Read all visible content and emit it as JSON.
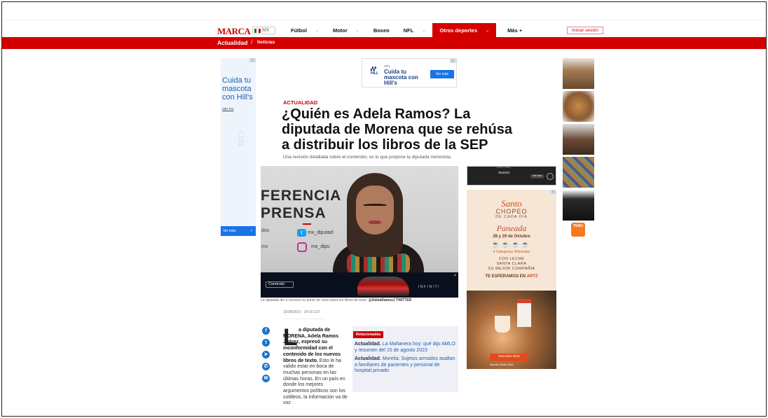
{
  "nav": {
    "logo": "MARCA",
    "edition": "MX",
    "items": [
      {
        "label": "Fútbol",
        "dropdown": true
      },
      {
        "label": "Motor",
        "dropdown": true
      },
      {
        "label": "Boxeo",
        "dropdown": false
      },
      {
        "label": "NFL",
        "dropdown": true
      },
      {
        "label": "Otros deportes",
        "dropdown": true,
        "active": true
      },
      {
        "label": "Más +",
        "dropdown": false
      }
    ],
    "login": "Iniciar sesión"
  },
  "section_bar": {
    "section": "Actualidad",
    "separator": "/",
    "subsection": "Noticias"
  },
  "ads": {
    "left": {
      "headline": "Cuida tu mascota con Hill's",
      "small": "Hills Pet",
      "cta": "Ver más"
    },
    "top": {
      "label": "Hill's",
      "headline": "Cuida tu mascota con Hill's",
      "cta": "Ver más"
    },
    "video": {
      "cta": "Conócelo",
      "brand": "INFINITI"
    },
    "car": {
      "label": "PUBLICIDAD",
      "text": "SUZUKI",
      "cta": "Ver más"
    },
    "santa_clara": {
      "title1": "Santo",
      "title2": "CHOPEO",
      "title3": "DE CADA DÍA",
      "title4": "Paneada",
      "dates": "28 y 29 de Octubre",
      "category": "4 Categorías Diferentes",
      "line1": "CON LECHE",
      "line2": "SANTA CLARA",
      "line3": "SU MEJOR COMPAÑÍA",
      "cta_prefix": "TE ESPERAMOS EN",
      "cta_place": "ARTZ",
      "button": "Descubre MÁS",
      "fine": "Atención Santa Clara"
    },
    "temu": "TEMU"
  },
  "article": {
    "kicker": "ACTUALIDAD",
    "title": "¿Quién es Adela Ramos? La diputada de Morena que se rehúsa a distribuir los libros de la SEP",
    "subtitle": "Una revisión detallada sobre el contenido, es lo que propone la diputada morenista.",
    "photo": {
      "word1": "FERENCIA",
      "word2": "PRENSA",
      "handle_tw": "mx_diputad",
      "handle_ig": "mx_dipu",
      "side1": "dos",
      "side2": "mx"
    },
    "caption_text": "La diputada dio a conocer su punto de vista sobre los libros de texto.",
    "caption_credit": "@AdelaRamosJ TWITTER",
    "date": "15/08/2023 - 14:16 CST",
    "dropcap": "L",
    "lead_bold": "a diputada de MORENA, Adela Ramos Juárez, expresó su inconformidad con el contenido de los nuevos libros de texto.",
    "lead_rest": "Esto le ha valido estar en boca de muchas personas en las últimas horas. En un país en donde los mejores argumentos políticos son los cotilleos, la información va de voz"
  },
  "related": {
    "tag": "Relacionadas",
    "items": [
      {
        "section": "Actualidad.",
        "title": "La Mañanera hoy: qué dijo AMLO y resumen del 15 de agosto 2023"
      },
      {
        "section": "Actualidad.",
        "title": "Morelia: Sujetos armados asaltan a familiares de pacientes y personal de hospital privado"
      }
    ]
  },
  "colors": {
    "brand_red": "#d40000",
    "link_blue": "#1a5fb4"
  }
}
